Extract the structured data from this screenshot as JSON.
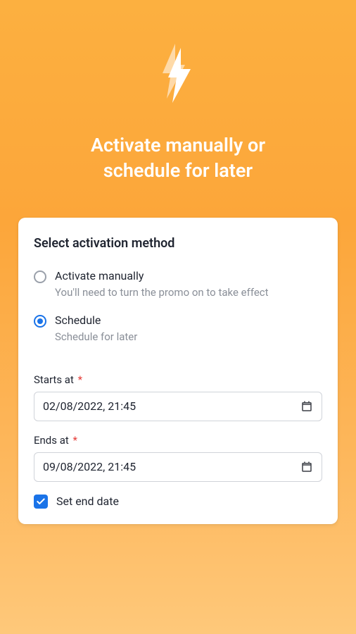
{
  "hero": {
    "title": "Activate manually or schedule for later"
  },
  "card": {
    "heading": "Select activation method",
    "options": {
      "manual": {
        "label": "Activate manually",
        "desc": "You'll need to turn the promo on to take effect"
      },
      "schedule": {
        "label": "Schedule",
        "desc": "Schedule for later"
      }
    },
    "fields": {
      "start": {
        "label": "Starts at",
        "value": "02/08/2022, 21:45"
      },
      "end": {
        "label": "Ends at",
        "value": "09/08/2022, 21:45"
      }
    },
    "setEndDate": {
      "label": "Set end date"
    }
  }
}
